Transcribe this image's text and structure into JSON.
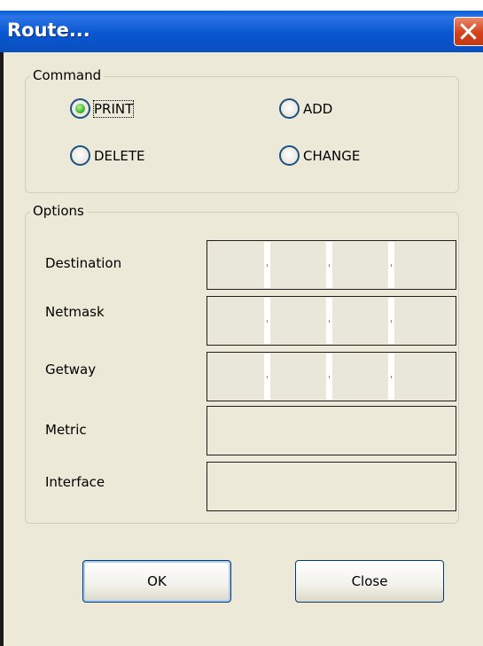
{
  "window": {
    "title": "Route..."
  },
  "command": {
    "legend": "Command",
    "options": [
      {
        "label": "PRINT",
        "selected": true
      },
      {
        "label": "ADD",
        "selected": false
      },
      {
        "label": "DELETE",
        "selected": false
      },
      {
        "label": "CHANGE",
        "selected": false
      }
    ]
  },
  "options": {
    "legend": "Options",
    "fields": [
      {
        "label": "Destination",
        "value": ""
      },
      {
        "label": "Netmask",
        "value": ""
      },
      {
        "label": "Getway",
        "value": ""
      },
      {
        "label": "Metric",
        "value": ""
      },
      {
        "label": "Interface",
        "value": ""
      }
    ]
  },
  "buttons": {
    "ok": "OK",
    "close": "Close"
  },
  "colors": {
    "titlebar": "#0a5fd8",
    "dialog_bg": "#ece9d8",
    "close_button": "#d3411b",
    "radio_selected": "#35b21d"
  }
}
